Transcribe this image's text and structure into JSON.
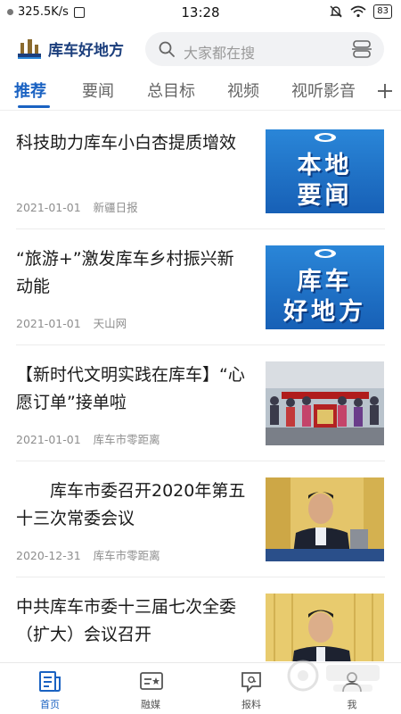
{
  "status_bar": {
    "speed": "325.5K/s",
    "time": "13:28",
    "battery": "83"
  },
  "header": {
    "logo_text": "库车好地方",
    "search_placeholder": "大家都在搜"
  },
  "tabs": [
    "推荐",
    "要闻",
    "总目标",
    "视频",
    "视听影音"
  ],
  "news": [
    {
      "title": "科技助力库车小白杏提质增效",
      "date": "2021-01-01",
      "source": "新疆日报",
      "thumb_text": [
        "本地",
        "要闻"
      ]
    },
    {
      "title": "“旅游+”激发库车乡村振兴新动能",
      "date": "2021-01-01",
      "source": "天山网",
      "thumb_text": [
        "库车",
        "好地方"
      ]
    },
    {
      "title": "【新时代文明实践在库车】“心愿订单”接单啦",
      "date": "2021-01-01",
      "source": "库车市零距离"
    },
    {
      "title": "　　库车市委召开2020年第五十三次常委会议",
      "date": "2020-12-31",
      "source": "库车市零距离"
    },
    {
      "title": "中共库车市委十三届七次全委（扩大）会议召开"
    }
  ],
  "bottom_nav": [
    {
      "label": "首页",
      "icon": "news-icon"
    },
    {
      "label": "融媒",
      "icon": "media-card-icon"
    },
    {
      "label": "报料",
      "icon": "report-chat-icon"
    },
    {
      "label": "我",
      "icon": "person-icon"
    }
  ],
  "colors": {
    "accent": "#1a62c2",
    "logo": "#1b3e7c"
  }
}
